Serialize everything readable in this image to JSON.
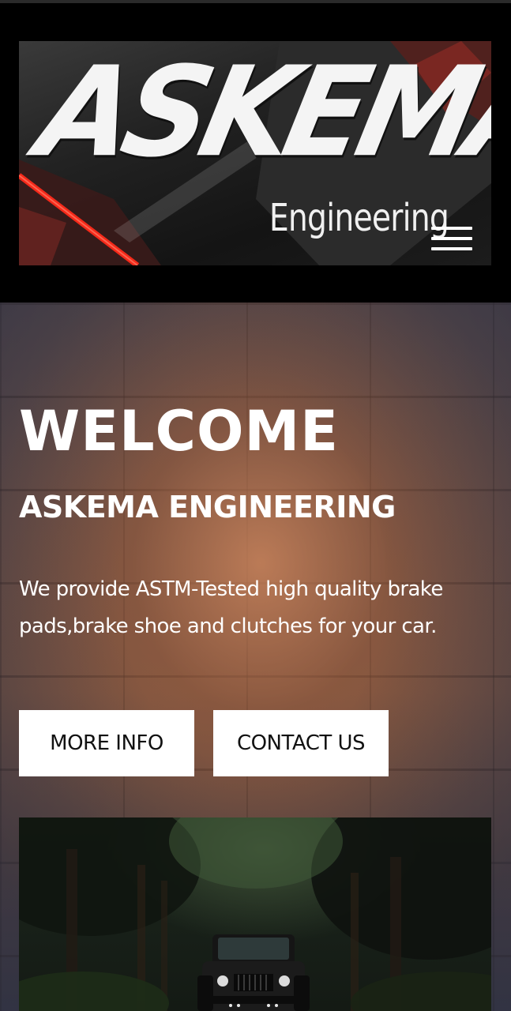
{
  "header": {
    "logo": {
      "main_text": "ASKEMA",
      "sub_text": "Engineering"
    },
    "menu_icon": "hamburger-menu-icon"
  },
  "hero": {
    "title": "WELCOME",
    "subtitle": "ASKEMA ENGINEERING",
    "description": "We provide ASTM-Tested high quality brake pads,brake shoe and clutches for your car.",
    "buttons": {
      "more_info": "MORE INFO",
      "contact_us": "CONTACT US"
    }
  },
  "colors": {
    "header_bg": "#000000",
    "button_bg": "#ffffff",
    "button_text": "#111111",
    "hero_text": "#ffffff",
    "logo_accent": "#d4281e"
  }
}
